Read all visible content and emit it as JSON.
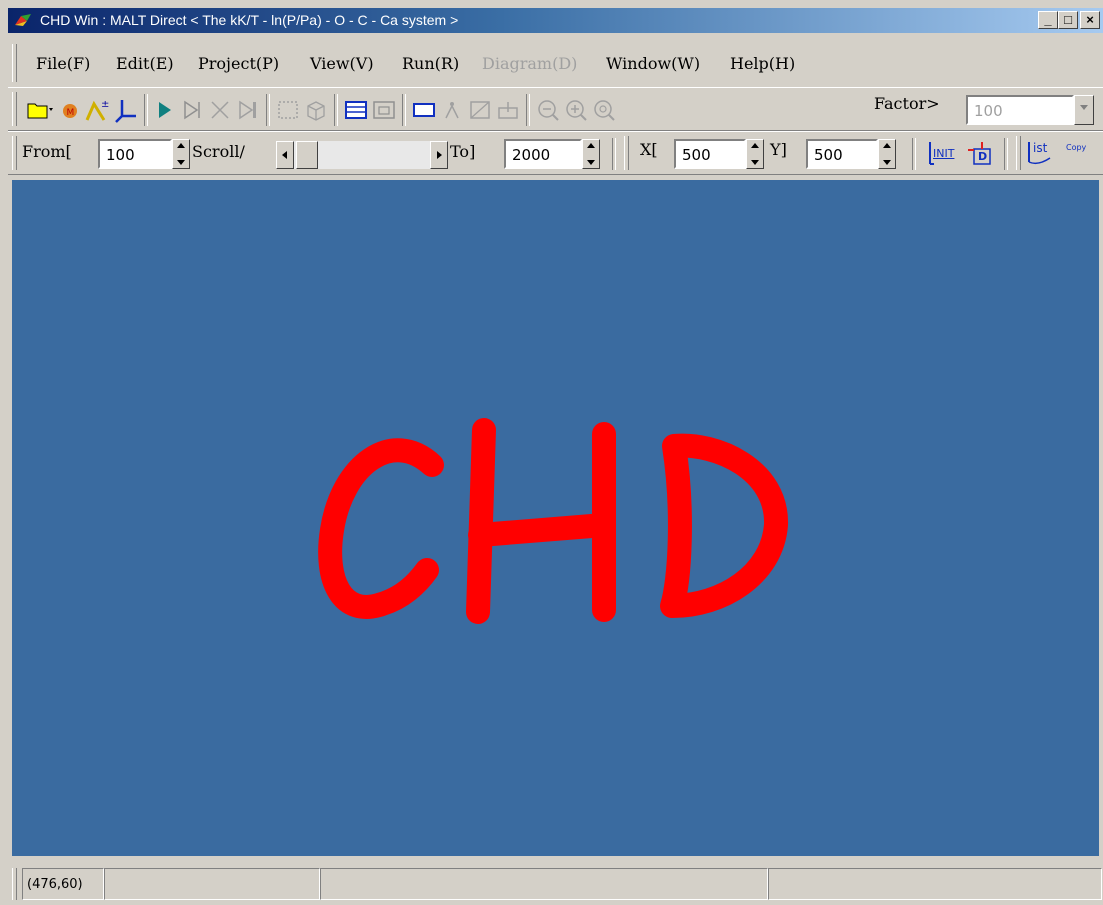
{
  "window": {
    "title": "CHD Win : MALT Direct  < The kK/T - ln(P/Pa) - O - C - Ca system >",
    "controls": {
      "minimize": "_",
      "maximize": "□",
      "close": "×"
    }
  },
  "menubar": {
    "items": [
      {
        "label": "File(F)",
        "enabled": true
      },
      {
        "label": "Edit(E)",
        "enabled": true
      },
      {
        "label": "Project(P)",
        "enabled": true
      },
      {
        "label": "View(V)",
        "enabled": true
      },
      {
        "label": "Run(R)",
        "enabled": true
      },
      {
        "label": "Diagram(D)",
        "enabled": false
      },
      {
        "label": "Window(W)",
        "enabled": true
      },
      {
        "label": "Help(H)",
        "enabled": true
      }
    ]
  },
  "toolbar1": {
    "factor_label": "Factor>",
    "factor_value": "100"
  },
  "toolbar2": {
    "from_label": "From[",
    "from_value": "100",
    "scroll_label": "Scroll/",
    "to_label": "To]",
    "to_value": "2000",
    "x_label": "X[",
    "x_value": "500",
    "y_label": "Y]",
    "y_value": "500",
    "init_label": "INIT",
    "d_label": "D",
    "list_label": "ist",
    "copy_label": "Copy"
  },
  "canvas": {
    "text": "CHD",
    "background": "#3a6ba0",
    "text_color": "#ff0000"
  },
  "statusbar": {
    "coords": "(476,60)"
  }
}
